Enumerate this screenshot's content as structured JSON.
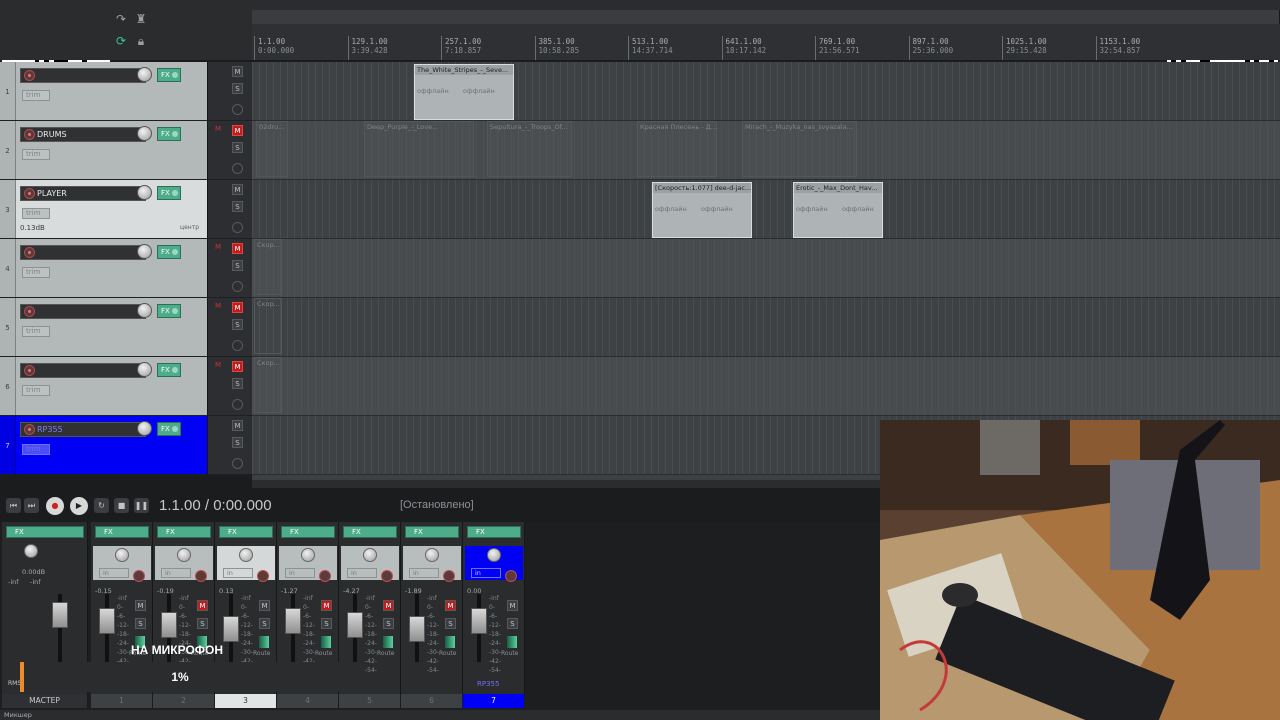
{
  "transport": {
    "position": "1.1.00 / 0:00.000",
    "state": "[Остановлено]"
  },
  "ruler": {
    "ticks": [
      {
        "bar": "1.1.00",
        "time": "0:00.000"
      },
      {
        "bar": "129.1.00",
        "time": "3:39.428"
      },
      {
        "bar": "257.1.00",
        "time": "7:18.857"
      },
      {
        "bar": "385.1.00",
        "time": "10:58.285"
      },
      {
        "bar": "513.1.00",
        "time": "14:37.714"
      },
      {
        "bar": "641.1.00",
        "time": "18:17.142"
      },
      {
        "bar": "769.1.00",
        "time": "21:56.571"
      },
      {
        "bar": "897.1.00",
        "time": "25:36.000"
      },
      {
        "bar": "1025.1.00",
        "time": "29:15.428"
      },
      {
        "bar": "1153.1.00",
        "time": "32:54.857"
      }
    ]
  },
  "tracks": [
    {
      "num": "1",
      "name": "",
      "mute": false,
      "trim": "trim"
    },
    {
      "num": "2",
      "name": "DRUMS",
      "mute": true,
      "trim": "trim"
    },
    {
      "num": "3",
      "name": "PLAYER",
      "mute": false,
      "trim": "trim",
      "db": "0.13dB",
      "pan": "центр"
    },
    {
      "num": "4",
      "name": "",
      "mute": true,
      "trim": "trim"
    },
    {
      "num": "5",
      "name": "",
      "mute": true,
      "trim": "trim"
    },
    {
      "num": "6",
      "name": "",
      "mute": true,
      "trim": "trim"
    },
    {
      "num": "7",
      "name": "RP355",
      "mute": false,
      "trim": "trim"
    }
  ],
  "buttons": {
    "fx": "FX",
    "m": "M",
    "s": "S",
    "in": "in",
    "route": "Route"
  },
  "items": {
    "lane1": [
      {
        "name": "The_White_Stripes_-_Seve...",
        "off1": "оффлайн",
        "off2": "оффлайн"
      }
    ],
    "lane2": [
      {
        "name": "Deep_Purple_-_Love..."
      },
      {
        "name": "Sepultura_-_Troops_Of..."
      },
      {
        "name": "Красная Плесень - Д..."
      },
      {
        "name": "Mirach_-_Muzyka_nas_svyazala..."
      },
      {
        "name": "02dru..."
      }
    ],
    "lane3": [
      {
        "name": "[Скорость:1.077] dee-d-jac...",
        "off1": "оффлайн",
        "off2": "оффлайн"
      },
      {
        "name": "Erotic_-_Max_Dont_Hav...",
        "off1": "оффлайн",
        "off2": "оффлайн"
      }
    ],
    "ghost": "Скор..."
  },
  "mixer": {
    "master": {
      "label": "МАСТЕР",
      "vol": "0.00dB",
      "left": "-inf",
      "right": "-inf",
      "rms": "RMS"
    },
    "strips": [
      {
        "num": "1",
        "vol": "-0.15",
        "mute": false
      },
      {
        "num": "2",
        "vol": "-0.19",
        "mute": true
      },
      {
        "num": "3",
        "vol": "0.13",
        "mute": false
      },
      {
        "num": "4",
        "vol": "-1.27",
        "mute": true
      },
      {
        "num": "5",
        "vol": "-4.27",
        "mute": true
      },
      {
        "num": "6",
        "vol": "-1.89",
        "mute": true
      },
      {
        "num": "7",
        "vol": "0.00",
        "mute": false,
        "name": "RP355"
      }
    ],
    "scale": [
      "-inf",
      "0-",
      "-6-",
      "-12-",
      "-18-",
      "-24-",
      "-30-",
      "-42-",
      "-54-"
    ]
  },
  "overlay": {
    "title": "НА МИКРОФОН",
    "percent": "1%",
    "progress": 0.01
  },
  "bottom": {
    "tab": "Микшер"
  },
  "colors": {
    "selected": "#0000f5",
    "mute": "#c01e1e",
    "fx": "#4dac8a",
    "progress": "#f08a24"
  }
}
